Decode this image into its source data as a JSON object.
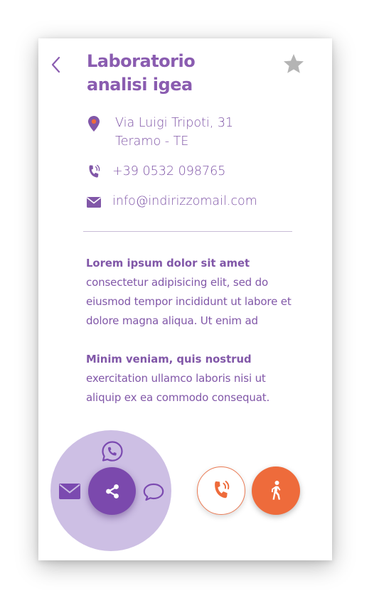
{
  "header": {
    "title": "Laboratorio analisi igea",
    "back_icon": "chevron-left-icon",
    "favorite_icon": "star-icon"
  },
  "contact": {
    "address_line1": "Via Luigi Tripoti, 31",
    "address_line2": "Teramo - TE",
    "phone": "+39 0532 098765",
    "email": "info@indirizzomail.com",
    "icons": [
      "location-pin-icon",
      "phone-icon",
      "envelope-icon"
    ]
  },
  "description": [
    {
      "lead": "Lorem ipsum dolor sit amet",
      "body": "consectetur adipisicing elit, sed do eiusmod tempor incididunt ut labore et dolore magna aliqua. Ut enim ad"
    },
    {
      "lead": "Minim veniam, quis nostrud",
      "body": "exercitation ullamco laboris nisi ut aliquip ex ea commodo consequat."
    }
  ],
  "actions": {
    "share_options": [
      "whatsapp-icon",
      "envelope-icon",
      "chat-bubble-icon"
    ],
    "share_icon": "share-icon",
    "call_icon": "phone-icon",
    "directions_icon": "walking-person-icon"
  },
  "colors": {
    "primary": "#8157a8",
    "primary_dark": "#7b49ad",
    "share_halo": "#cdbfe4",
    "accent": "#ee6b3b",
    "star": "#b4b4b4",
    "divider": "#c8bcd6"
  }
}
